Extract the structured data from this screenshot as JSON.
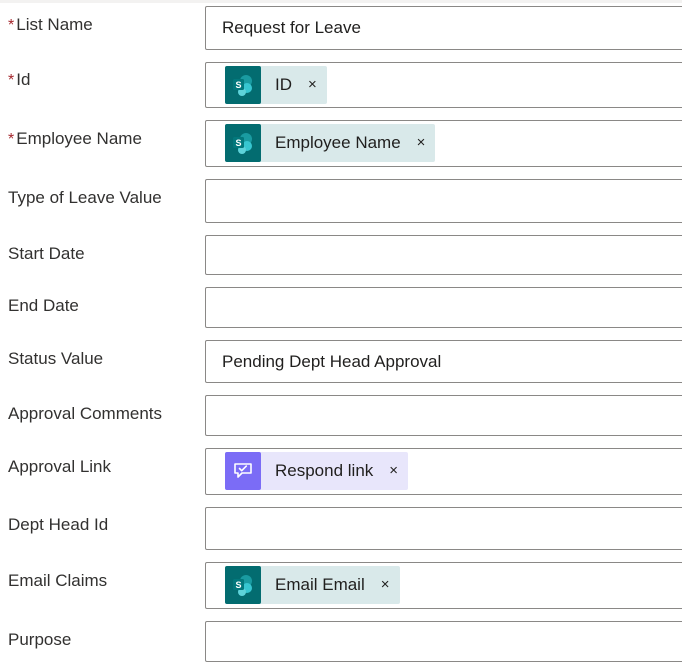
{
  "fields": [
    {
      "label": "List Name",
      "required": true,
      "value": "Request for Leave",
      "tokens": []
    },
    {
      "label": "Id",
      "required": true,
      "value": "",
      "tokens": [
        {
          "type": "sharepoint",
          "label": "ID"
        }
      ]
    },
    {
      "label": "Employee Name",
      "required": true,
      "value": "",
      "tokens": [
        {
          "type": "sharepoint",
          "label": "Employee Name"
        }
      ]
    },
    {
      "label": "Type of Leave Value",
      "required": false,
      "value": "",
      "tokens": []
    },
    {
      "label": "Start Date",
      "required": false,
      "value": "",
      "tokens": []
    },
    {
      "label": "End Date",
      "required": false,
      "value": "",
      "tokens": []
    },
    {
      "label": "Status Value",
      "required": false,
      "value": "Pending Dept Head Approval",
      "tokens": []
    },
    {
      "label": "Approval Comments",
      "required": false,
      "value": "",
      "tokens": []
    },
    {
      "label": "Approval Link",
      "required": false,
      "value": "",
      "tokens": [
        {
          "type": "approvals",
          "label": "Respond link"
        }
      ]
    },
    {
      "label": "Dept Head Id",
      "required": false,
      "value": "",
      "tokens": []
    },
    {
      "label": "Email Claims",
      "required": false,
      "value": "",
      "tokens": [
        {
          "type": "sharepoint",
          "label": "Email Email"
        }
      ]
    },
    {
      "label": "Purpose",
      "required": false,
      "value": "",
      "tokens": []
    }
  ],
  "required_marker": "*",
  "token_remove_glyph": "×",
  "icons": {
    "sharepoint": "sharepoint-icon",
    "approvals": "approvals-icon"
  },
  "colors": {
    "required": "#a4262c",
    "sharepoint_icon_bg": "#036c70",
    "sharepoint_token_bg": "#d9e9ea",
    "approvals_icon_bg": "#7b6cf6",
    "approvals_token_bg": "#e8e6fb",
    "field_border": "#8a8886"
  }
}
